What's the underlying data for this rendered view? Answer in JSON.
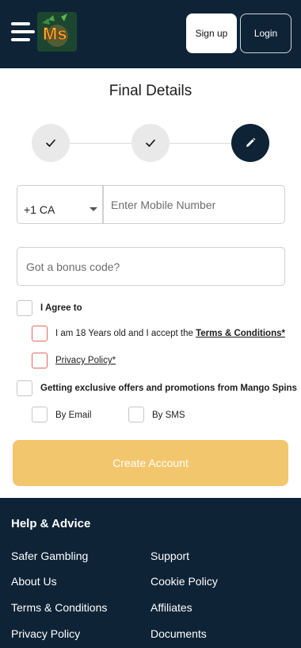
{
  "header": {
    "logo_text": "Ms",
    "signup_label": "Sign up",
    "login_label": "Login"
  },
  "page": {
    "title": "Final Details"
  },
  "stepper": {
    "steps": [
      {
        "state": "done",
        "icon": "check-icon"
      },
      {
        "state": "done",
        "icon": "check-icon"
      },
      {
        "state": "active",
        "icon": "pencil-icon"
      }
    ]
  },
  "form": {
    "country_code": "+1 CA",
    "phone_placeholder": "Enter Mobile Number",
    "bonus_placeholder": "Got a bonus code?",
    "agree_label": "I Agree to",
    "age_text": "I am 18 Years old and I accept the ",
    "terms_link": "Terms & Conditions*",
    "privacy_link": "Privacy Policy*",
    "offers_label": "Getting exclusive offers and promotions from Mango Spins",
    "by_email_label": "By Email",
    "by_sms_label": "By SMS",
    "create_button": "Create Account"
  },
  "footer": {
    "title": "Help & Advice",
    "links_left": [
      "Safer Gambling",
      "About Us",
      "Terms & Conditions",
      "Privacy Policy"
    ],
    "links_right": [
      "Support",
      "Cookie Policy",
      "Affiliates",
      "Documents"
    ]
  },
  "colors": {
    "navy": "#0e2336",
    "accent_yellow": "#f2c66d",
    "checkbox_error": "#e0685f"
  }
}
